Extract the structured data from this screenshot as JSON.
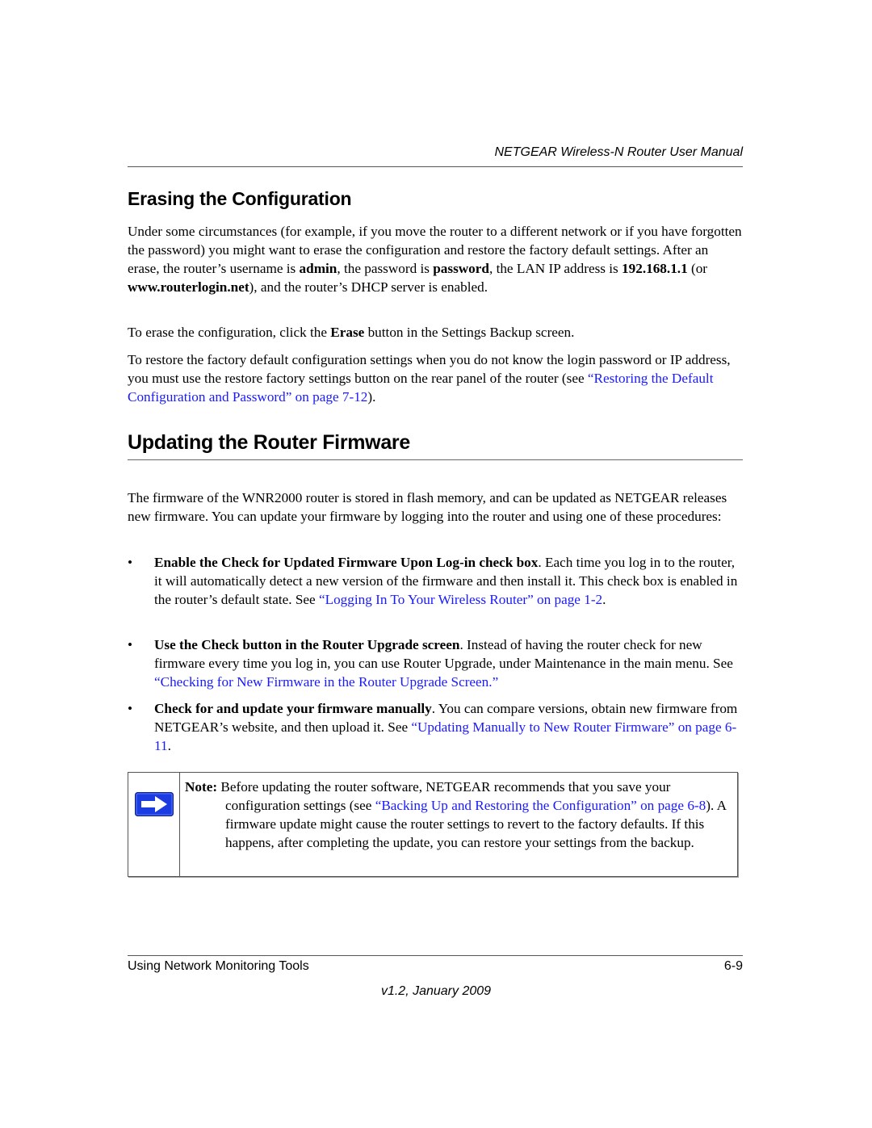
{
  "header": {
    "prefix": "NETGEAR ",
    "title_italic": "Wireless-N Router User Manual"
  },
  "section_erase": {
    "heading": "Erasing the Configuration",
    "para1": {
      "t1": "Under some circumstances (for example, if you move the router to a different network or if you have forgotten the password) you might want to erase the configuration and restore the factory default settings. After an erase, the router’s username is ",
      "b1": "admin",
      "t2": ", the password is ",
      "b2": "password",
      "t3": ", the LAN IP address is ",
      "b3": "192.168.1.1",
      "t4": " (or ",
      "b4": "www.routerlogin.net",
      "t5": "), and the router’s DHCP server is enabled."
    },
    "para2": {
      "t1": "To erase the configuration, click the ",
      "b1": "Erase",
      "t2": " button in the Settings Backup screen."
    },
    "para3": {
      "t1": "To restore the factory default configuration settings when you do not know the login password or IP address, you must use the restore factory settings button on the rear panel of the router (see ",
      "link": "“Restoring the Default Configuration and Password” on page 7-12",
      "t2": ")."
    }
  },
  "section_update": {
    "heading": "Updating the Router Firmware",
    "intro": "The firmware of the WNR2000 router is stored in flash memory, and can be updated as NETGEAR releases new firmware. You can update your firmware by logging into the router and using one of these procedures:",
    "bullet_char": "•",
    "bullets": [
      {
        "bold": "Enable the Check for Updated Firmware Upon Log-in check box",
        "text": ". Each time you log in to the router, it will automatically detect a new version of the firmware and then install it. This check box is enabled in the router’s default state. See ",
        "link": "“Logging In To Your Wireless Router” on page 1-2",
        "after": "."
      },
      {
        "bold": "Use the Check button in the Router Upgrade screen",
        "text": ". Instead of having the router check for new firmware every time you log in, you can use Router Upgrade, under Maintenance in the main menu. See ",
        "link": "“Checking for New Firmware in the Router Upgrade Screen.”",
        "after": ""
      },
      {
        "bold": "Check for and update your firmware manually",
        "text": ". You can compare versions, obtain new firmware from NETGEAR’s website, and then upload it. See ",
        "link": "“Updating Manually to New Router Firmware” on page 6-11",
        "after": "."
      }
    ],
    "note": {
      "icon": "arrow-right-icon",
      "label": "Note:",
      "t1": " Before updating the router software, NETGEAR recommends that you save your",
      "t2": "configuration settings (see ",
      "link": "“Backing Up and Restoring the Configuration” on page 6-8",
      "t3": "). A firmware update might cause the router settings to revert to the factory defaults. If this happens, after completing the update, you can restore your settings from the backup.",
      "icon_color": "#1a3ce0"
    }
  },
  "footer": {
    "chapter": "Using Network Monitoring Tools",
    "page": "6-9",
    "version": "v1.2, January 2009"
  },
  "colors": {
    "link": "#1a1aff",
    "rule": "#555555"
  }
}
